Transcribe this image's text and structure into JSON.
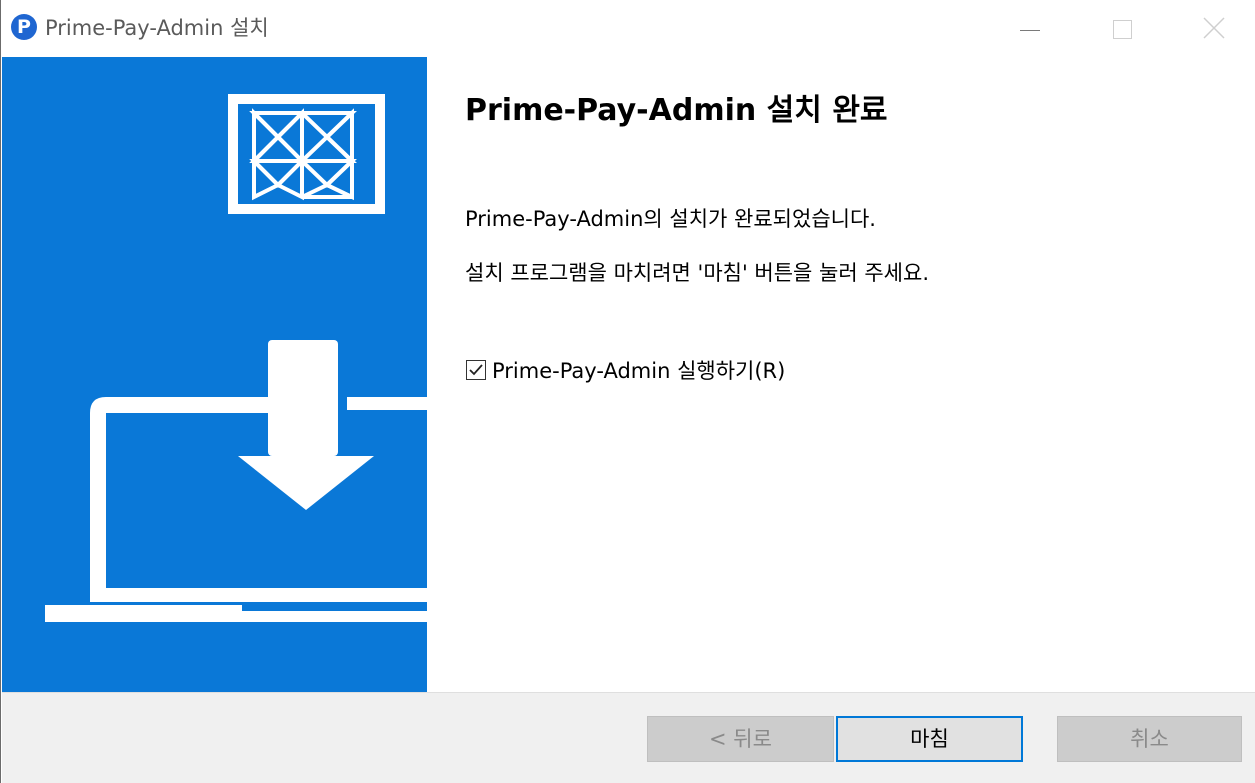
{
  "window": {
    "title": "Prime-Pay-Admin 설치",
    "app_icon_letter": "P"
  },
  "content": {
    "heading": "Prime-Pay-Admin 설치 완료",
    "message_line1": "Prime-Pay-Admin의 설치가 완료되었습니다.",
    "message_line2": "설치 프로그램을 마치려면 '마침' 버튼을 눌러 주세요.",
    "run_checkbox_label": "Prime-Pay-Admin 실행하기(R)",
    "run_checkbox_checked": true
  },
  "buttons": {
    "back_label": "< 뒤로",
    "finish_label": "마침",
    "cancel_label": "취소"
  },
  "colors": {
    "sidebar_blue": "#0a78d7",
    "accent": "#0078d7"
  }
}
